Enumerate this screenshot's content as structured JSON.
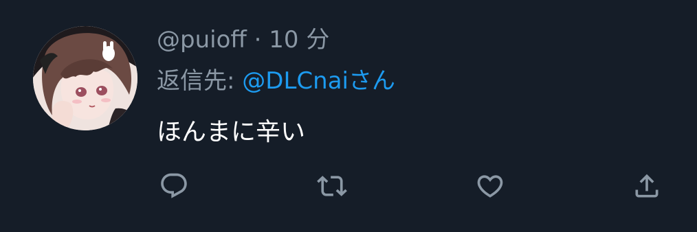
{
  "tweet": {
    "handle": "@puioff",
    "separator": "·",
    "time": "10 分",
    "reply_prefix": "返信先:",
    "reply_mention": "@DLCnai",
    "reply_suffix": "さん",
    "text": "ほんまに辛い"
  },
  "actions": {
    "reply_icon": "reply-icon",
    "retweet_icon": "retweet-icon",
    "like_icon": "heart-icon",
    "share_icon": "share-icon"
  },
  "colors": {
    "background": "#151d28",
    "secondary_text": "#8b98a5",
    "mention": "#1d9bf0",
    "primary_text": "#ffffff"
  }
}
